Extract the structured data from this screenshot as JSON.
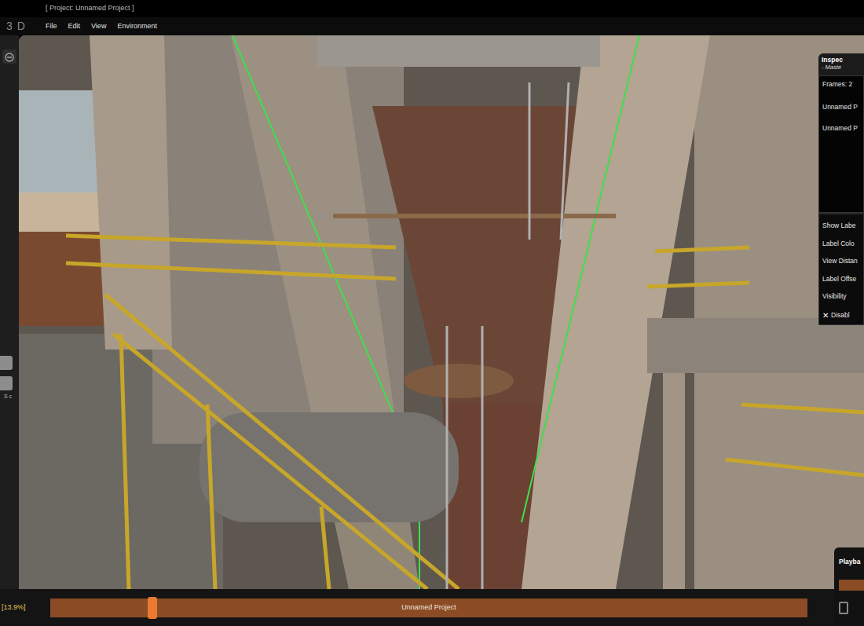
{
  "window": {
    "title": "[ Project: Unnamed Project ]",
    "logo": "3 D"
  },
  "menu": [
    {
      "label": "File"
    },
    {
      "label": "Edit"
    },
    {
      "label": "View"
    },
    {
      "label": "Environment"
    }
  ],
  "left_toolbar": {
    "letters": "S c"
  },
  "inspector": {
    "title": "Inspec",
    "subtitle": "- Maste",
    "frames": "Frames: 2",
    "items": [
      "Unnamed P",
      "Unnamed P"
    ],
    "properties": [
      "Show Labe",
      "Label Colo",
      "View Distan",
      "Label Offse",
      "Visibility"
    ],
    "disable": {
      "icon": "✕",
      "label": "Disabl"
    }
  },
  "timeline": {
    "zoom": "[13.9%]",
    "label": "Unnamed Project",
    "level": 0.135
  },
  "playback": {
    "title": "Playba"
  }
}
